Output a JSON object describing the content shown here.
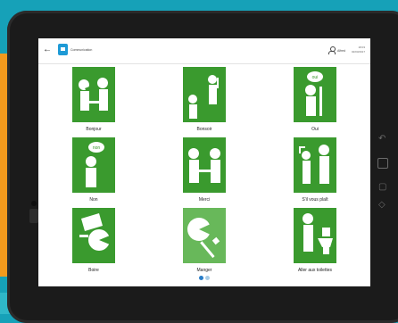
{
  "header": {
    "back_icon": "arrow-left-icon",
    "app_title": "Communication",
    "user_name": "Alfred",
    "time": "18:03",
    "date": "02/03/2017"
  },
  "cards": [
    {
      "label": "Bonjour",
      "icon": "greeting-handshake-icon"
    },
    {
      "label": "Bonsoir",
      "icon": "waving-person-icon"
    },
    {
      "label": "Oui",
      "icon": "yes-speech-icon"
    },
    {
      "label": "Non",
      "icon": "no-speech-icon"
    },
    {
      "label": "Merci",
      "icon": "thanks-handshake-icon"
    },
    {
      "label": "S'il vous plaît",
      "icon": "please-icon"
    },
    {
      "label": "Boire",
      "icon": "drink-icon"
    },
    {
      "label": "Manger",
      "icon": "eat-icon"
    },
    {
      "label": "Aller aux toilettes",
      "icon": "toilet-icon"
    }
  ],
  "pictogram_text": {
    "oui": "oui",
    "non": "non"
  },
  "pagination": {
    "current": 1,
    "total": 2
  },
  "colors": {
    "pictogram_green": "#3a9a2e",
    "selected_green": "#68b85a",
    "accent_blue": "#1e9ad6",
    "page_dot_active": "#2a7ec8"
  }
}
